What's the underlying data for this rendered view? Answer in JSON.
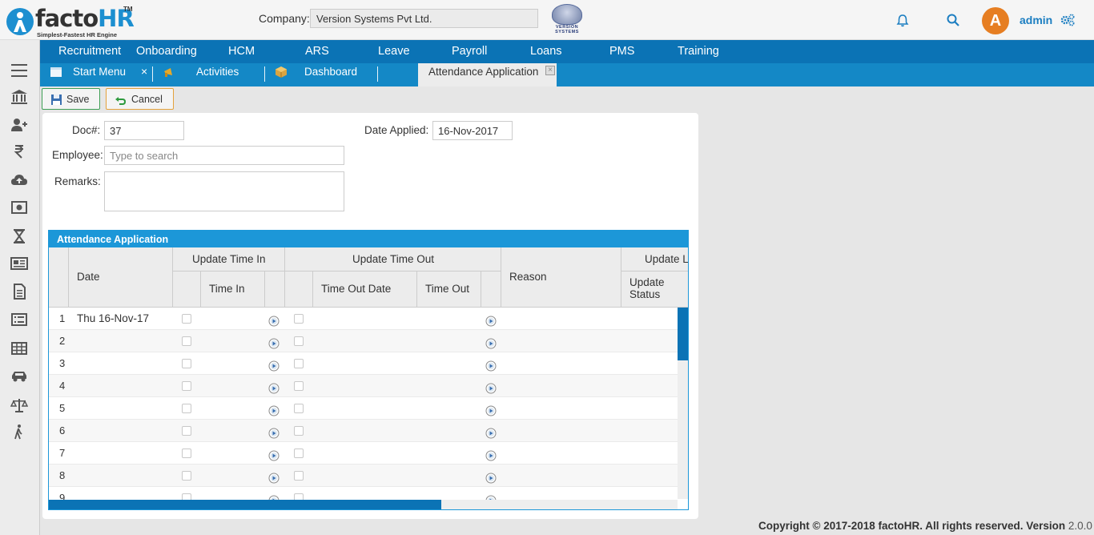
{
  "header": {
    "logo_main": "facto",
    "logo_hr": "HR",
    "logo_tm": "TM",
    "logo_tagline": "Simplest-Fastest HR Engine",
    "company_label": "Company:",
    "company_value": "Version Systems Pvt Ltd.",
    "company_logo_text": "VERSION SYSTEMS",
    "avatar_initial": "A",
    "username": "admin"
  },
  "mainmenu": {
    "items": [
      "Recruitment",
      "Onboarding",
      "HCM",
      "ARS",
      "Leave",
      "Payroll",
      "Loans",
      "PMS",
      "Training"
    ]
  },
  "tabs": {
    "start_menu": "Start Menu",
    "close": "×",
    "activities": "Activities",
    "dashboard": "Dashboard",
    "active": "Attendance Application",
    "active_close": "×"
  },
  "toolbar": {
    "save_label": "Save",
    "cancel_label": "Cancel"
  },
  "form": {
    "doc_label": "Doc#:",
    "doc_value": "37",
    "date_applied_label": "Date Applied:",
    "date_applied_value": "16-Nov-2017",
    "employee_label": "Employee:",
    "employee_placeholder": "Type to search",
    "remarks_label": "Remarks:"
  },
  "grid": {
    "title": "Attendance Application",
    "headers": {
      "date": "Date",
      "update_time_in": "Update Time In",
      "time_in": "Time In",
      "update_time_out": "Update Time Out",
      "time_out_date": "Time Out Date",
      "time_out": "Time Out",
      "reason": "Reason",
      "update_l": "Update L",
      "update_status_1": "Update",
      "update_status_2": "Status"
    },
    "rows": [
      {
        "n": "1",
        "date": "Thu 16-Nov-17"
      },
      {
        "n": "2",
        "date": ""
      },
      {
        "n": "3",
        "date": ""
      },
      {
        "n": "4",
        "date": ""
      },
      {
        "n": "5",
        "date": ""
      },
      {
        "n": "6",
        "date": ""
      },
      {
        "n": "7",
        "date": ""
      },
      {
        "n": "8",
        "date": ""
      },
      {
        "n": "9",
        "date": ""
      }
    ]
  },
  "footer": {
    "copyright": "Copyright © 2017-2018 factoHR.  All rights reserved.  Version ",
    "version": "2.0.0"
  },
  "colors": {
    "menu_bg": "#0b73b5",
    "tab_bg": "#1488c6",
    "grid_accent": "#1c97d8",
    "brand_blue": "#1d8fd0",
    "avatar": "#e67e22"
  }
}
